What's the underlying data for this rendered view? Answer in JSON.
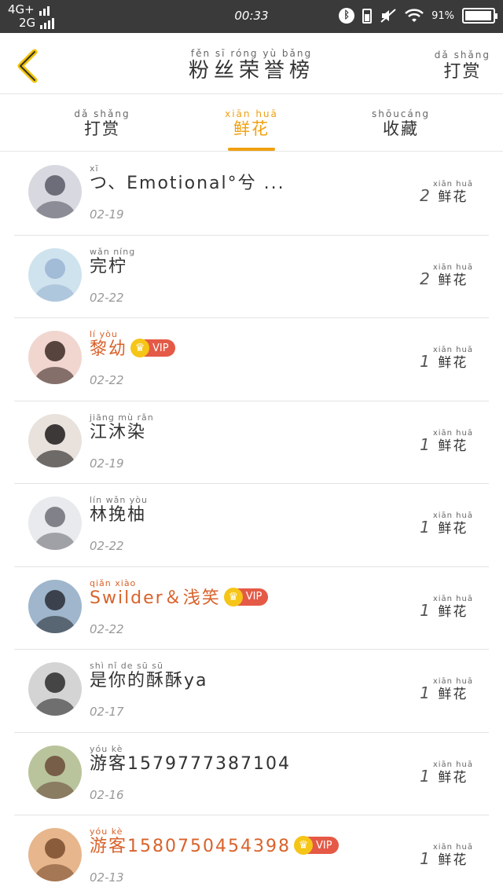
{
  "status_bar": {
    "network_top": "4G+",
    "network_bottom": "2G",
    "time": "00:33",
    "battery_level": "91%",
    "icons": [
      "bluetooth-icon",
      "battery-icon",
      "mute-icon",
      "wifi-icon"
    ]
  },
  "header": {
    "title_pinyin": "fěn sī róng yù bǎng",
    "title": "粉丝荣誉榜",
    "action_pinyin": "dǎ shǎng",
    "action": "打赏"
  },
  "tabs": [
    {
      "pinyin": "dǎ shǎng",
      "label": "打赏",
      "active": false
    },
    {
      "pinyin": "xiān huā",
      "label": "鲜花",
      "active": true
    },
    {
      "pinyin": "shōucáng",
      "label": "收藏",
      "active": false
    }
  ],
  "flower_pinyin": "xiān huā",
  "flower_label": "鲜花",
  "fans": [
    {
      "pinyin": "xī",
      "name": "つ、Emotional°兮 ...",
      "date": "02-19",
      "count": "2",
      "vip": false,
      "avatar_colors": [
        "#d8d8e0",
        "#5a5a66"
      ]
    },
    {
      "pinyin": "wǎn níng",
      "name": "完柠",
      "date": "02-22",
      "count": "2",
      "vip": false,
      "avatar_colors": [
        "#cfe3ee",
        "#9ab4d2"
      ]
    },
    {
      "pinyin": "lí yòu",
      "name": "黎幼",
      "date": "02-22",
      "count": "1",
      "vip": true,
      "vip_label": "VIP",
      "avatar_colors": [
        "#f1d6d0",
        "#3c2a26"
      ]
    },
    {
      "pinyin": "jiāng mù rǎn",
      "name": "江沐染",
      "date": "02-19",
      "count": "1",
      "vip": false,
      "avatar_colors": [
        "#e9e2dc",
        "#1d1a1a"
      ]
    },
    {
      "pinyin": "lín wǎn yòu",
      "name": "林挽柚",
      "date": "02-22",
      "count": "1",
      "vip": false,
      "avatar_colors": [
        "#e8eaee",
        "#6e7077"
      ]
    },
    {
      "pinyin": "qiǎn xiào",
      "name": "Swilder＆浅笑",
      "date": "02-22",
      "count": "1",
      "vip": true,
      "vip_label": "VIP",
      "avatar_colors": [
        "#9fb6cc",
        "#2a2e36"
      ]
    },
    {
      "pinyin": "shì nǐ de sū sū",
      "name": "是你的酥酥ya",
      "date": "02-17",
      "count": "1",
      "vip": false,
      "avatar_colors": [
        "#d4d4d4",
        "#2b2b2b"
      ]
    },
    {
      "pinyin": "yóu kè",
      "name": "游客1579777387104",
      "date": "02-16",
      "count": "1",
      "vip": false,
      "avatar_colors": [
        "#b9c49c",
        "#6b4c3a"
      ]
    },
    {
      "pinyin": "yóu kè",
      "name": "游客15807504543​98",
      "date": "02-13",
      "count": "1",
      "vip": true,
      "vip_label": "VIP",
      "avatar_colors": [
        "#e7b68c",
        "#7a4c2e"
      ]
    }
  ]
}
